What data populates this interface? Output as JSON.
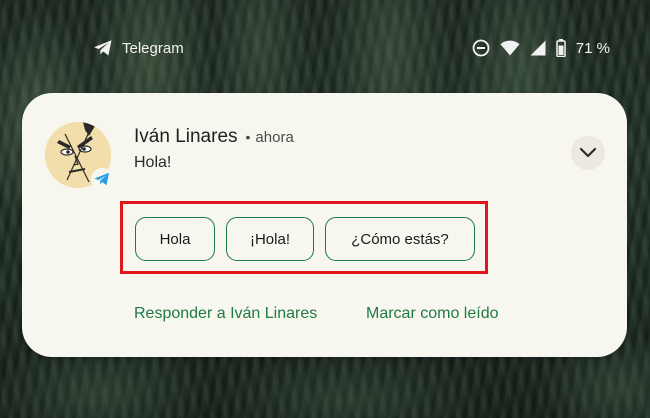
{
  "status_bar": {
    "app_name": "Telegram",
    "battery": "71 %",
    "icons": [
      "telegram-icon",
      "do-not-disturb-icon",
      "wifi-icon",
      "cellular-signal-icon",
      "battery-icon"
    ]
  },
  "notification": {
    "sender": "Iván Linares",
    "separator": "•",
    "time": "ahora",
    "message": "Hola!",
    "expand_icon": "chevron-down-icon",
    "quick_replies": [
      "Hola",
      "¡Hola!",
      "¿Cómo estás?"
    ],
    "actions": {
      "reply": "Responder a Iván Linares",
      "mark_read": "Marcar como leído"
    }
  },
  "colors": {
    "card_background": "#f8f7ef",
    "accent_green": "#1f7a44",
    "highlight_red": "#e0161b",
    "telegram_blue": "#2a9ee6"
  }
}
